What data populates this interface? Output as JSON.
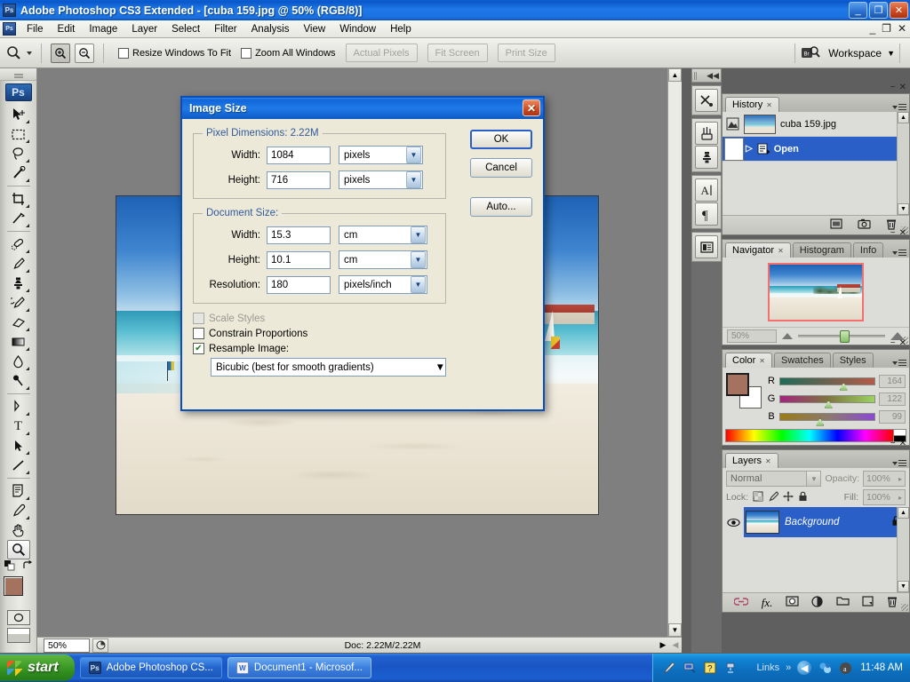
{
  "window": {
    "title": "Adobe Photoshop CS3 Extended - [cuba 159.jpg @ 50% (RGB/8)]",
    "app_icon": "Ps",
    "minimize": "_",
    "restore": "❐",
    "close": "✕"
  },
  "menubar": {
    "app_icon": "Ps",
    "items": [
      "File",
      "Edit",
      "Image",
      "Layer",
      "Select",
      "Filter",
      "Analysis",
      "View",
      "Window",
      "Help"
    ],
    "doc_controls": [
      "_",
      "❐",
      "✕"
    ]
  },
  "options_bar": {
    "tool_icon": "zoom-tool",
    "zoom_in_label": "+",
    "zoom_out_label": "−",
    "resize_windows_label": "Resize Windows To Fit",
    "zoom_all_windows_label": "Zoom All Windows",
    "actual_pixels_label": "Actual Pixels",
    "fit_screen_label": "Fit Screen",
    "print_size_label": "Print Size",
    "bridge_label": "Br",
    "workspace_label": "Workspace"
  },
  "toolbox": {
    "logo": "Ps",
    "tools": [
      {
        "name": "move-tool",
        "glyph": "➤"
      },
      {
        "name": "marquee-tool",
        "glyph": "▭"
      },
      {
        "name": "lasso-tool",
        "glyph": "◠"
      },
      {
        "name": "magic-wand-tool",
        "glyph": "✦"
      },
      {
        "name": "crop-tool",
        "glyph": "⌗"
      },
      {
        "name": "eyedropper-slice-tool",
        "glyph": "✂"
      },
      {
        "name": "healing-brush-tool",
        "glyph": "◔"
      },
      {
        "name": "brush-tool",
        "glyph": "✎"
      },
      {
        "name": "clone-stamp-tool",
        "glyph": "⚷"
      },
      {
        "name": "history-brush-tool",
        "glyph": "✐"
      },
      {
        "name": "eraser-tool",
        "glyph": "▱"
      },
      {
        "name": "gradient-tool",
        "glyph": "▤"
      },
      {
        "name": "blur-tool",
        "glyph": "◌"
      },
      {
        "name": "dodge-tool",
        "glyph": "⚲"
      },
      {
        "name": "pen-tool",
        "glyph": "✒"
      },
      {
        "name": "type-tool",
        "glyph": "T"
      },
      {
        "name": "path-selection-tool",
        "glyph": "➚"
      },
      {
        "name": "line-shape-tool",
        "glyph": "╲"
      },
      {
        "name": "notes-tool",
        "glyph": "▤"
      },
      {
        "name": "eyedropper-tool",
        "glyph": "⚲"
      },
      {
        "name": "hand-tool",
        "glyph": "✋"
      },
      {
        "name": "zoom-tool",
        "glyph": "🔍"
      }
    ],
    "foreground_color": "#a4725f",
    "background_color": "#ffffff",
    "quick_mask_label": "◯",
    "screen_mode_label": "▣"
  },
  "mini_dock": {
    "buttons": [
      {
        "name": "tool-presets-icon",
        "glyph": "✂"
      },
      {
        "name": "brushes-icon",
        "glyph": "⚘"
      },
      {
        "name": "clone-source-icon",
        "glyph": "⚷"
      },
      {
        "name": "character-icon",
        "glyph": "A"
      },
      {
        "name": "paragraph-icon",
        "glyph": "¶"
      },
      {
        "name": "layer-comps-icon",
        "glyph": "▤"
      }
    ]
  },
  "history_panel": {
    "tabs": [
      {
        "label": "History",
        "active": true
      }
    ],
    "snapshot": "cuba 159.jpg",
    "states": [
      {
        "label": "Open",
        "selected": true
      }
    ],
    "footer_buttons": [
      "new-document-icon",
      "new-snapshot-icon",
      "delete-icon"
    ]
  },
  "navigator_panel": {
    "tabs": [
      {
        "label": "Navigator",
        "active": true
      },
      {
        "label": "Histogram",
        "active": false
      },
      {
        "label": "Info",
        "active": false
      }
    ],
    "zoom_value": "50%"
  },
  "color_panel": {
    "tabs": [
      {
        "label": "Color",
        "active": true
      },
      {
        "label": "Swatches",
        "active": false
      },
      {
        "label": "Styles",
        "active": false
      }
    ],
    "channels": [
      {
        "label": "R",
        "value": "164",
        "pct": 64
      },
      {
        "label": "G",
        "value": "122",
        "pct": 48
      },
      {
        "label": "B",
        "value": "99",
        "pct": 39
      }
    ],
    "foreground": "#a4725f",
    "background": "#ffffff"
  },
  "layers_panel": {
    "tabs": [
      {
        "label": "Layers",
        "active": true
      }
    ],
    "blend_mode": "Normal",
    "opacity_label": "Opacity:",
    "opacity_value": "100%",
    "lock_label": "Lock:",
    "fill_label": "Fill:",
    "fill_value": "100%",
    "layers": [
      {
        "name": "Background",
        "locked": true,
        "visible": true
      }
    ],
    "footer_buttons": [
      "link-icon",
      "fx-icon",
      "mask-icon",
      "adjustment-icon",
      "group-icon",
      "new-layer-icon",
      "delete-layer-icon"
    ]
  },
  "document": {
    "zoom": "50%",
    "doc_info": "Doc: 2.22M/2.22M"
  },
  "dialog": {
    "title": "Image Size",
    "close_label": "✕",
    "pixel_dimensions": {
      "legend": "Pixel Dimensions:  2.22M",
      "width_label": "Width:",
      "width_value": "1084",
      "width_unit": "pixels",
      "height_label": "Height:",
      "height_value": "716",
      "height_unit": "pixels"
    },
    "document_size": {
      "legend": "Document Size:",
      "width_label": "Width:",
      "width_value": "15.3",
      "width_unit": "cm",
      "height_label": "Height:",
      "height_value": "10.1",
      "height_unit": "cm",
      "resolution_label": "Resolution:",
      "resolution_value": "180",
      "resolution_unit": "pixels/inch"
    },
    "checkboxes": {
      "scale_styles_label": "Scale Styles",
      "scale_styles_checked": false,
      "constrain_label": "Constrain Proportions",
      "constrain_checked": false,
      "resample_label": "Resample Image:",
      "resample_checked": true,
      "resample_check_glyph": "✔"
    },
    "resample_method": "Bicubic (best for smooth gradients)",
    "buttons": {
      "ok": "OK",
      "cancel": "Cancel",
      "auto": "Auto..."
    }
  },
  "taskbar": {
    "start_label": "start",
    "items": [
      {
        "label": "Adobe Photoshop CS...",
        "icon": "Ps",
        "active": false
      },
      {
        "label": "Document1 - Microsof...",
        "icon": "W",
        "active": true
      }
    ],
    "quick_launch_label": "Links",
    "quick_launch_chevron": "»",
    "tray_icons": [
      "pen-icon",
      "network-icon",
      "help-icon",
      "connection-icon"
    ],
    "clock": "11:48 AM"
  }
}
